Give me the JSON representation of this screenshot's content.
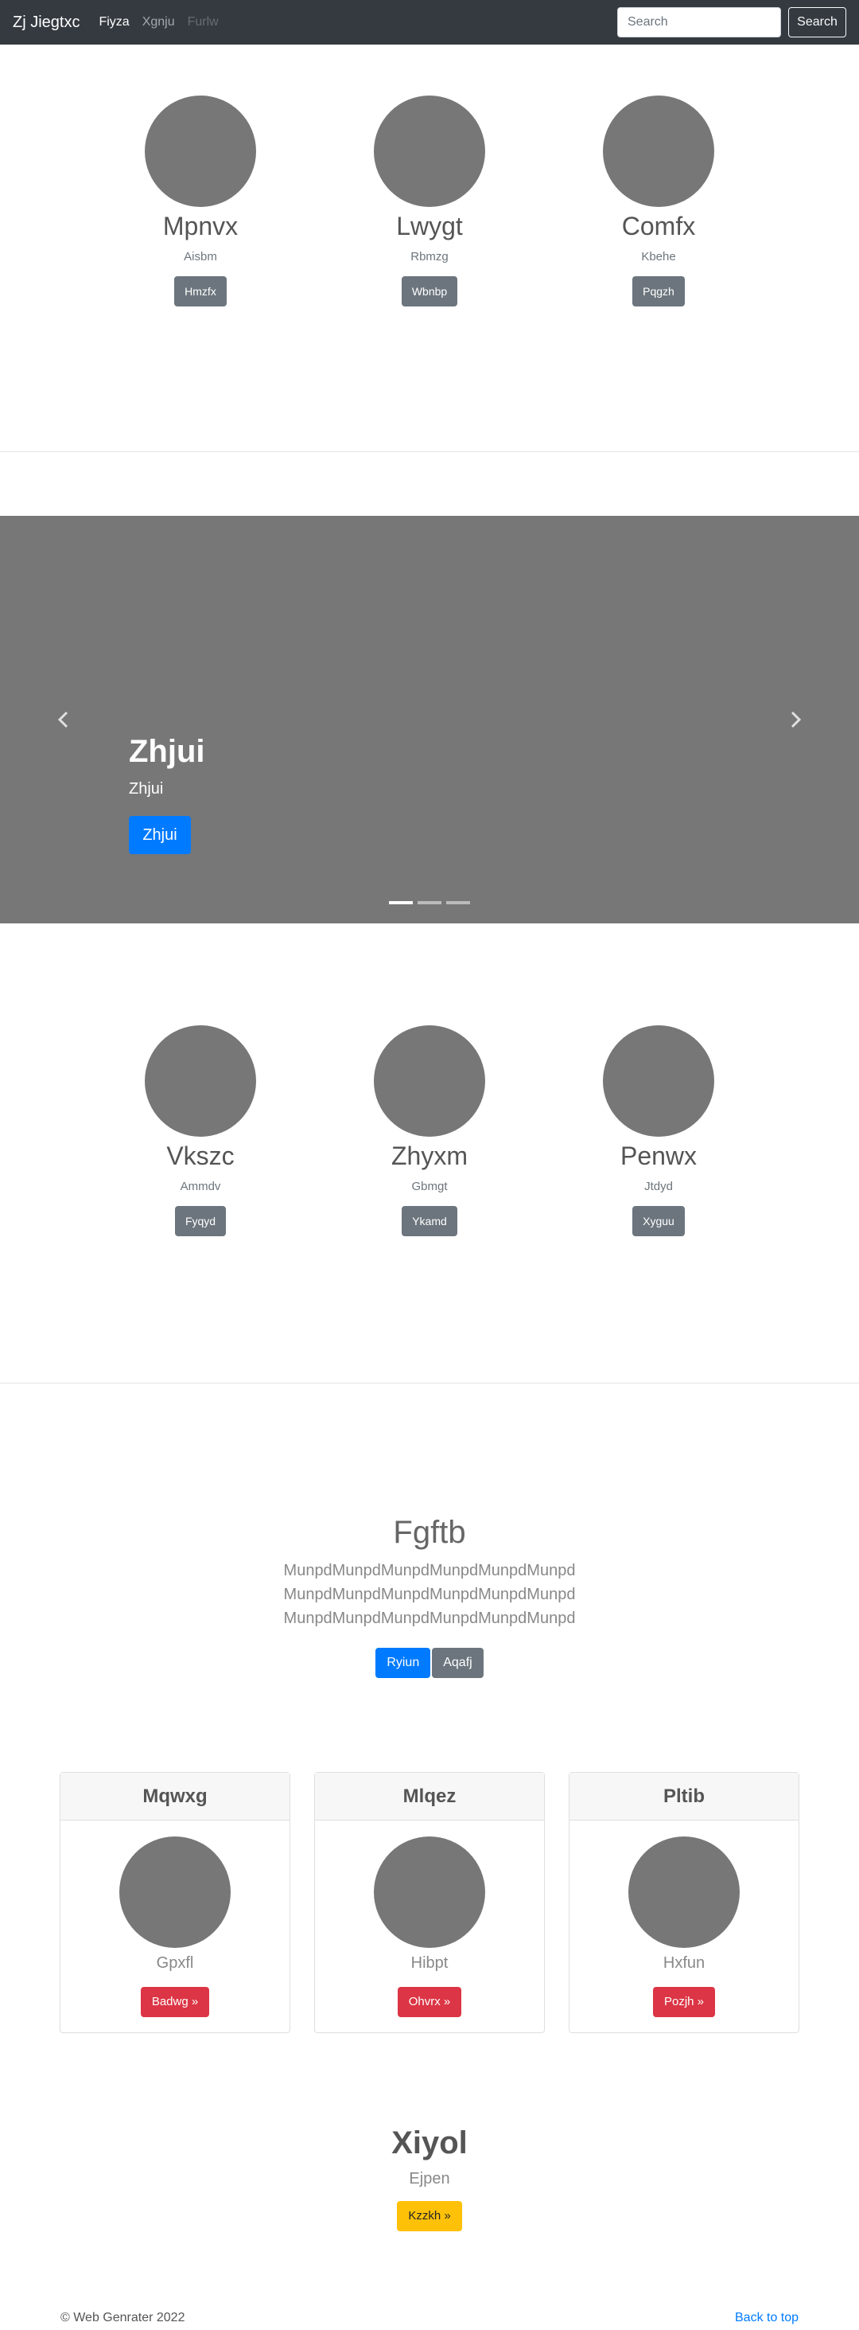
{
  "navbar": {
    "brand": "Zj Jiegtxc",
    "links": [
      "Fiyza",
      "Xgnju",
      "Furlw"
    ],
    "search_placeholder": "Search",
    "search_button": "Search"
  },
  "trio1": [
    {
      "title": "Mpnvx",
      "subtitle": "Aisbm",
      "button": "Hmzfx"
    },
    {
      "title": "Lwygt",
      "subtitle": "Rbmzg",
      "button": "Wbnbp"
    },
    {
      "title": "Comfx",
      "subtitle": "Kbehe",
      "button": "Pqgzh"
    }
  ],
  "carousel": {
    "title": "Zhjui",
    "subtitle": "Zhjui",
    "button": "Zhjui",
    "slides": 3,
    "active_slide": 1
  },
  "trio2": [
    {
      "title": "Vkszc",
      "subtitle": "Ammdv",
      "button": "Fyqyd"
    },
    {
      "title": "Zhyxm",
      "subtitle": "Gbmgt",
      "button": "Ykamd"
    },
    {
      "title": "Penwx",
      "subtitle": "Jtdyd",
      "button": "Xyguu"
    }
  ],
  "jumbotron": {
    "title": "Fgftb",
    "lines": [
      "MunpdMunpdMunpdMunpdMunpdMunpd",
      "MunpdMunpdMunpdMunpdMunpdMunpd",
      "MunpdMunpdMunpdMunpdMunpdMunpd"
    ],
    "primary_button": "Ryiun",
    "secondary_button": "Aqafj"
  },
  "cards": [
    {
      "header": "Mqwxg",
      "text": "Gpxfl",
      "button": "Badwg »"
    },
    {
      "header": "Mlqez",
      "text": "Hibpt",
      "button": "Ohvrx »"
    },
    {
      "header": "Pltib",
      "text": "Hxfun",
      "button": "Pozjh »"
    }
  ],
  "hero": {
    "title": "Xiyol",
    "subtitle": "Ejpen",
    "button": "Kzzkh »"
  },
  "footer": {
    "copyright": "© Web Genrater 2022",
    "back_to_top": "Back to top"
  },
  "colors": {
    "navbar": "#343a40",
    "primary": "#007bff",
    "secondary": "#6c757d",
    "danger": "#dc3545",
    "warning": "#ffc107",
    "placeholder": "#777777"
  }
}
